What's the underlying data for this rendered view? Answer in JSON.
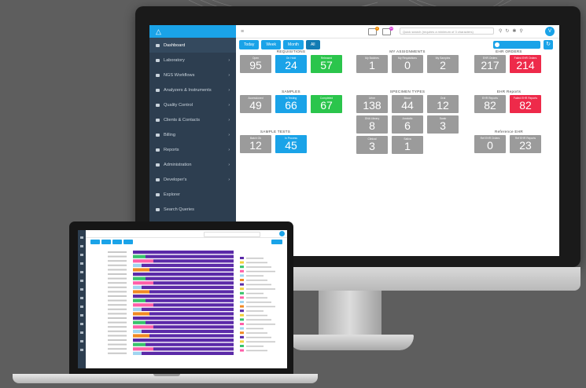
{
  "sidebar": {
    "items": [
      {
        "label": "Dashboard",
        "active": true,
        "chevron": false
      },
      {
        "label": "Laboratory",
        "chevron": true
      },
      {
        "label": "NGS Workflows",
        "chevron": true
      },
      {
        "label": "Analyzers & Instruments",
        "chevron": true
      },
      {
        "label": "Quality Control",
        "chevron": true
      },
      {
        "label": "Clients & Contacts",
        "chevron": true
      },
      {
        "label": "Billing",
        "chevron": true
      },
      {
        "label": "Reports",
        "chevron": true
      },
      {
        "label": "Administration",
        "chevron": true
      },
      {
        "label": "Developer's",
        "chevron": true
      },
      {
        "label": "Explorer",
        "chevron": false
      },
      {
        "label": "Search Queries",
        "chevron": false
      },
      {
        "label": "Settings And Preferences",
        "chevron": false
      }
    ]
  },
  "topbar": {
    "search_placeholder": "Quick search (requires a minimum of 3 characters)",
    "avatar_initial": "V",
    "badge_counts": [
      "4",
      "19"
    ]
  },
  "filters": [
    "Today",
    "Week",
    "Month",
    "All"
  ],
  "sections": {
    "requisitions": {
      "title": "REQUISITIONS",
      "tiles": [
        {
          "label": "Open",
          "value": "95",
          "color": "gray"
        },
        {
          "label": "On Hold",
          "value": "24",
          "color": "blue"
        },
        {
          "label": "Released",
          "value": "57",
          "color": "green"
        }
      ]
    },
    "samples": {
      "title": "SAMPLES",
      "tiles": [
        {
          "label": "Accessioned",
          "value": "49",
          "color": "gray"
        },
        {
          "label": "In Testing",
          "value": "66",
          "color": "blue"
        },
        {
          "label": "Completed",
          "value": "67",
          "color": "green"
        }
      ]
    },
    "sample_tests": {
      "title": "SAMPLE TESTS",
      "tiles": [
        {
          "label": "Batch Ok",
          "value": "12",
          "color": "gray"
        },
        {
          "label": "In Process",
          "value": "45",
          "color": "blue"
        }
      ]
    },
    "my_assignments": {
      "title": "MY ASSIGNMENTS",
      "tiles": [
        {
          "label": "My Batches",
          "value": "1",
          "color": "gray"
        },
        {
          "label": "My Requisitions",
          "value": "0",
          "color": "gray"
        },
        {
          "label": "My Samples",
          "value": "2",
          "color": "gray"
        }
      ]
    },
    "specimen_types": {
      "title": "SPECIMEN TYPES",
      "tiles": [
        {
          "label": "Urine",
          "value": "138",
          "color": "gray"
        },
        {
          "label": "Blood",
          "value": "44",
          "color": "gray"
        },
        {
          "label": "Oral",
          "value": "12",
          "color": "gray"
        },
        {
          "label": "DNA Library",
          "value": "8",
          "color": "gray"
        },
        {
          "label": "Amniotic",
          "value": "6",
          "color": "gray"
        },
        {
          "label": "Swab",
          "value": "3",
          "color": "gray"
        },
        {
          "label": "Clinical",
          "value": "3",
          "color": "gray"
        },
        {
          "label": "Saliva",
          "value": "1",
          "color": "gray"
        }
      ]
    },
    "ehr_orders": {
      "title": "EHR ORDERS",
      "tiles": [
        {
          "label": "EHR Orders",
          "value": "217",
          "color": "gray"
        },
        {
          "label": "Failed EHR Orders",
          "value": "214",
          "color": "red"
        }
      ]
    },
    "ehr_reports": {
      "title": "EHR Reports",
      "tiles": [
        {
          "label": "EHR Reports",
          "value": "82",
          "color": "gray"
        },
        {
          "label": "Failed EHR Reports",
          "value": "82",
          "color": "red"
        }
      ]
    },
    "reference_ehr": {
      "title": "Reference EHR",
      "tiles": [
        {
          "label": "Ref EHR Orders",
          "value": "0",
          "color": "gray"
        },
        {
          "label": "Ref EHR Reports",
          "value": "23",
          "color": "gray"
        }
      ]
    }
  },
  "colors": {
    "accent": "#1aa3e8",
    "sidebar": "#2d3e50",
    "tile_gray": "#9b9b9b",
    "tile_green": "#2bc54c",
    "tile_red": "#ee2a4a"
  }
}
